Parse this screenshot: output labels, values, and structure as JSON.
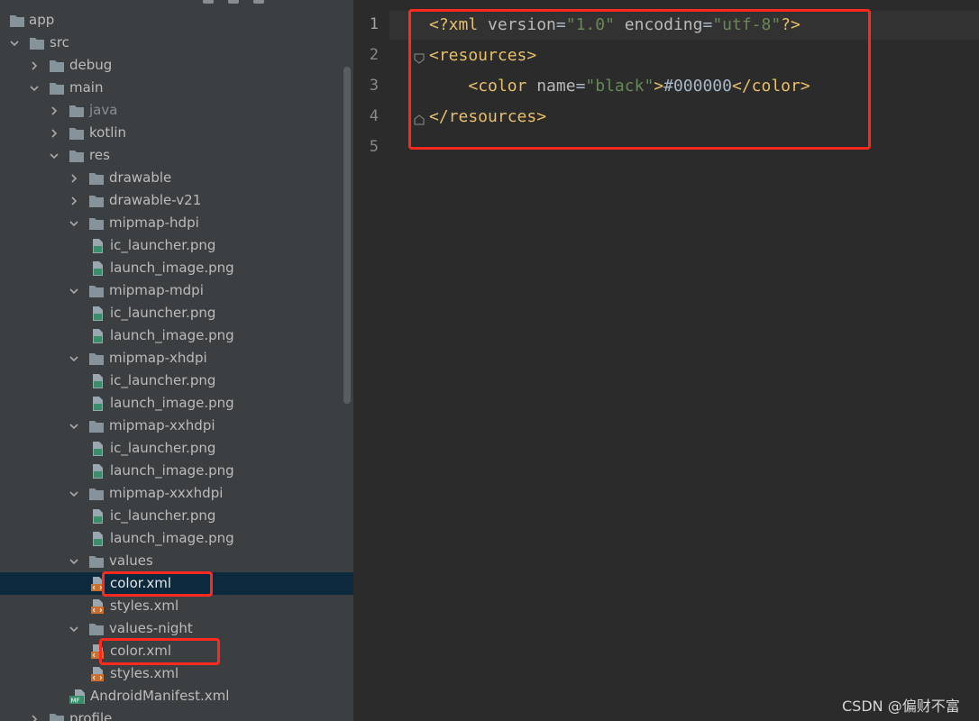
{
  "project_tree": {
    "items": [
      {
        "label": "app",
        "type": "root",
        "depth": 0,
        "expanded": null
      },
      {
        "label": "src",
        "type": "folder",
        "depth": 0,
        "expanded": true
      },
      {
        "label": "debug",
        "type": "folder",
        "depth": 1,
        "expanded": false
      },
      {
        "label": "main",
        "type": "folder",
        "depth": 1,
        "expanded": true
      },
      {
        "label": "java",
        "type": "folder",
        "depth": 2,
        "expanded": false
      },
      {
        "label": "kotlin",
        "type": "folder",
        "depth": 2,
        "expanded": false
      },
      {
        "label": "res",
        "type": "folder",
        "depth": 2,
        "expanded": true
      },
      {
        "label": "drawable",
        "type": "folder",
        "depth": 3,
        "expanded": false
      },
      {
        "label": "drawable-v21",
        "type": "folder",
        "depth": 3,
        "expanded": false
      },
      {
        "label": "mipmap-hdpi",
        "type": "folder",
        "depth": 3,
        "expanded": true
      },
      {
        "label": "ic_launcher.png",
        "type": "image-file",
        "depth": 4
      },
      {
        "label": "launch_image.png",
        "type": "image-file",
        "depth": 4
      },
      {
        "label": "mipmap-mdpi",
        "type": "folder",
        "depth": 3,
        "expanded": true
      },
      {
        "label": "ic_launcher.png",
        "type": "image-file",
        "depth": 4
      },
      {
        "label": "launch_image.png",
        "type": "image-file",
        "depth": 4
      },
      {
        "label": "mipmap-xhdpi",
        "type": "folder",
        "depth": 3,
        "expanded": true
      },
      {
        "label": "ic_launcher.png",
        "type": "image-file",
        "depth": 4
      },
      {
        "label": "launch_image.png",
        "type": "image-file",
        "depth": 4
      },
      {
        "label": "mipmap-xxhdpi",
        "type": "folder",
        "depth": 3,
        "expanded": true
      },
      {
        "label": "ic_launcher.png",
        "type": "image-file",
        "depth": 4
      },
      {
        "label": "launch_image.png",
        "type": "image-file",
        "depth": 4
      },
      {
        "label": "mipmap-xxxhdpi",
        "type": "folder",
        "depth": 3,
        "expanded": true
      },
      {
        "label": "ic_launcher.png",
        "type": "image-file",
        "depth": 4
      },
      {
        "label": "launch_image.png",
        "type": "image-file",
        "depth": 4
      },
      {
        "label": "values",
        "type": "folder",
        "depth": 3,
        "expanded": true
      },
      {
        "label": "color.xml",
        "type": "xml-file",
        "depth": 4,
        "selected": true
      },
      {
        "label": "styles.xml",
        "type": "xml-file",
        "depth": 4
      },
      {
        "label": "values-night",
        "type": "folder",
        "depth": 3,
        "expanded": true
      },
      {
        "label": "color.xml",
        "type": "xml-file",
        "depth": 4
      },
      {
        "label": "styles.xml",
        "type": "xml-file",
        "depth": 4
      },
      {
        "label": "AndroidManifest.xml",
        "type": "manifest-file",
        "depth": 3
      },
      {
        "label": "profile",
        "type": "folder",
        "depth": 1,
        "expanded": false
      }
    ]
  },
  "editor": {
    "line_numbers": [
      "1",
      "2",
      "3",
      "4",
      "5"
    ],
    "lines": [
      [
        {
          "t": "<?xml ",
          "c": "decl"
        },
        {
          "t": "version",
          "c": "attr"
        },
        {
          "t": "=",
          "c": "text"
        },
        {
          "t": "\"1.0\"",
          "c": "val"
        },
        {
          "t": " ",
          "c": "text"
        },
        {
          "t": "encoding",
          "c": "attr"
        },
        {
          "t": "=",
          "c": "text"
        },
        {
          "t": "\"utf-8\"",
          "c": "val"
        },
        {
          "t": "?>",
          "c": "decl"
        }
      ],
      [
        {
          "t": "<resources>",
          "c": "tag"
        }
      ],
      [
        {
          "t": "    ",
          "c": "text"
        },
        {
          "t": "<color ",
          "c": "tag"
        },
        {
          "t": "name",
          "c": "attr"
        },
        {
          "t": "=",
          "c": "text"
        },
        {
          "t": "\"black\"",
          "c": "val"
        },
        {
          "t": ">",
          "c": "tag"
        },
        {
          "t": "#000000",
          "c": "text"
        },
        {
          "t": "</color>",
          "c": "tag"
        }
      ],
      [
        {
          "t": "</resources>",
          "c": "tag"
        }
      ],
      []
    ]
  },
  "watermark": "CSDN @偏财不富",
  "colors": {
    "tree_bg": "#3c3f41",
    "editor_bg": "#2b2b2b",
    "selection": "#0d293e",
    "highlight_box": "#ff2a1f",
    "xml_tag": "#e8bf6a",
    "xml_value": "#6a8759",
    "xml_attr": "#bababa",
    "text": "#a9b7c6"
  }
}
